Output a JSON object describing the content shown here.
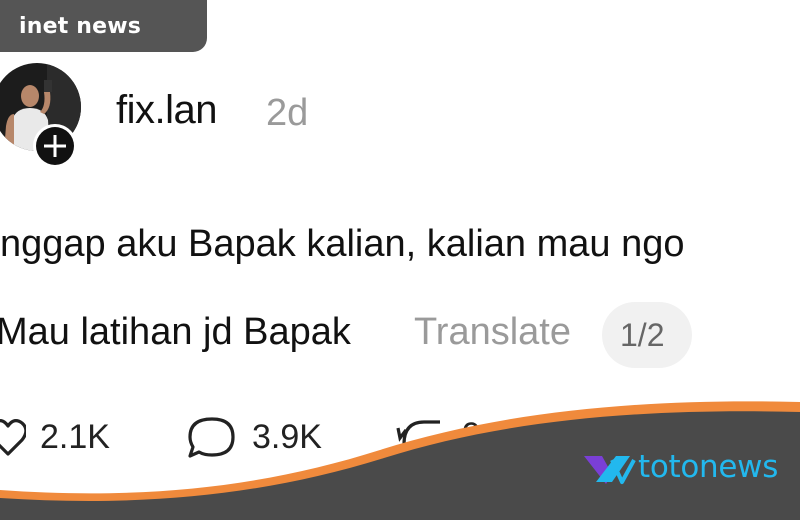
{
  "watermark_top": {
    "label": "inet news"
  },
  "post": {
    "username": "fix.lan",
    "time_ago": "2d",
    "line1": "nggap aku Bapak kalian, kalian mau ngo",
    "line2": "Mau latihan jd Bapak",
    "translate_label": "Translate",
    "pager": "1/2"
  },
  "stats": {
    "likes": "2.1K",
    "comments": "3.9K",
    "reposts": "9"
  },
  "watermark_bottom": {
    "label": "totonews"
  },
  "colors": {
    "badge_bg": "#555555",
    "wave_orange": "#f08a3c",
    "wave_dark": "#4a4a4a",
    "brand_blue": "#22b8ee",
    "brand_purple": "#7a3fd6"
  },
  "icons": {
    "add": "plus-circle-icon",
    "like": "heart-icon",
    "comment": "comment-bubble-icon",
    "repost": "repost-icon",
    "brand": "totonews-logo-icon"
  }
}
